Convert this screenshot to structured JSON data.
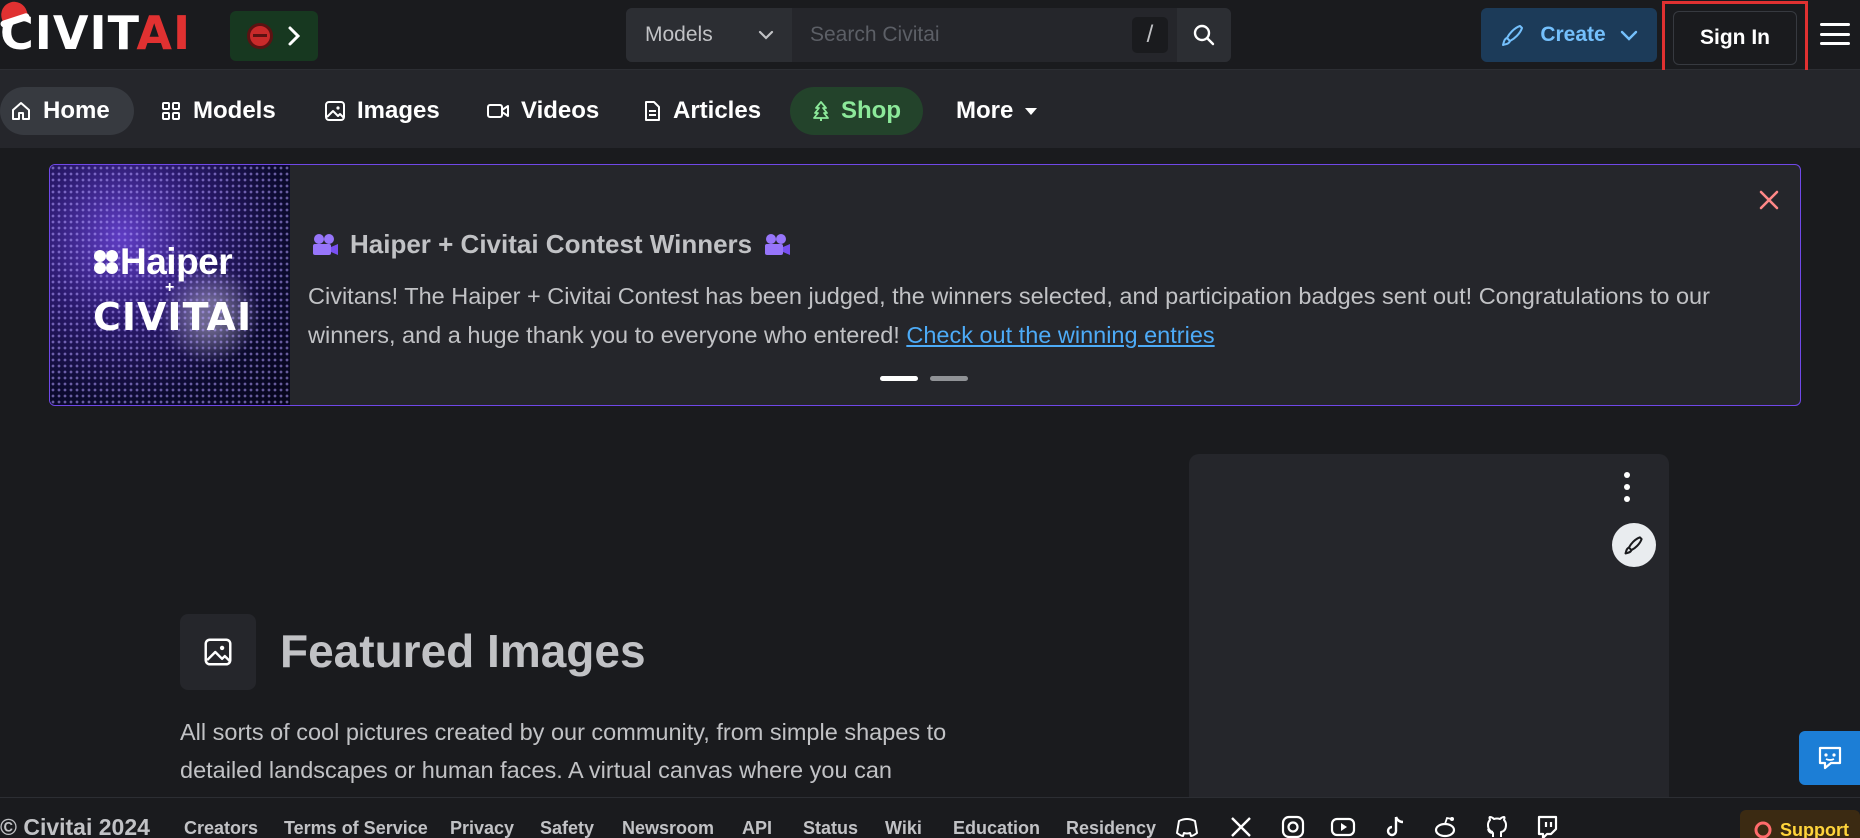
{
  "header": {
    "logo": {
      "civ": "CIVIT",
      "ai": "AI"
    },
    "search": {
      "category": "Models",
      "placeholder": "Search Civitai",
      "shortcut": "/"
    },
    "create_label": "Create",
    "signin_label": "Sign In"
  },
  "nav": {
    "items": [
      {
        "label": "Home",
        "icon": "home-icon"
      },
      {
        "label": "Models",
        "icon": "grid-icon"
      },
      {
        "label": "Images",
        "icon": "photo-icon"
      },
      {
        "label": "Videos",
        "icon": "video-icon"
      },
      {
        "label": "Articles",
        "icon": "file-text-icon"
      },
      {
        "label": "Shop",
        "icon": "tree-icon"
      },
      {
        "label": "More",
        "icon": "caret-down-icon"
      }
    ]
  },
  "banner": {
    "art_line1": "Haiper",
    "art_plus": "+",
    "art_line2": "CIVITAI",
    "title": "Haiper + Civitai Contest Winners",
    "text": "Civitans! The Haiper + Civitai Contest has been judged, the winners selected, and participation badges sent out! Congratulations to our winners, and a huge thank you to everyone who entered! ",
    "link": "Check out the winning entries",
    "active_slide": 1,
    "slide_count": 2
  },
  "featured": {
    "title": "Featured Images",
    "description": "All sorts of cool pictures created by our community, from simple shapes to detailed landscapes or human faces. A virtual canvas where you can"
  },
  "footer": {
    "copyright": "© Civitai 2024",
    "links": [
      "Creators",
      "Terms of Service",
      "Privacy",
      "Safety",
      "Newsroom",
      "API",
      "Status",
      "Wiki",
      "Education",
      "Residency"
    ],
    "social_icons": [
      "discord-icon",
      "x-icon",
      "instagram-icon",
      "youtube-icon",
      "tiktok-icon",
      "reddit-icon",
      "github-icon",
      "twitch-icon"
    ],
    "support_label": "Support"
  },
  "colors": {
    "brand_red": "#e03131",
    "accent_blue": "#1c7ed6",
    "shop_green": "#8ce99a",
    "banner_border": "#7048e8"
  }
}
